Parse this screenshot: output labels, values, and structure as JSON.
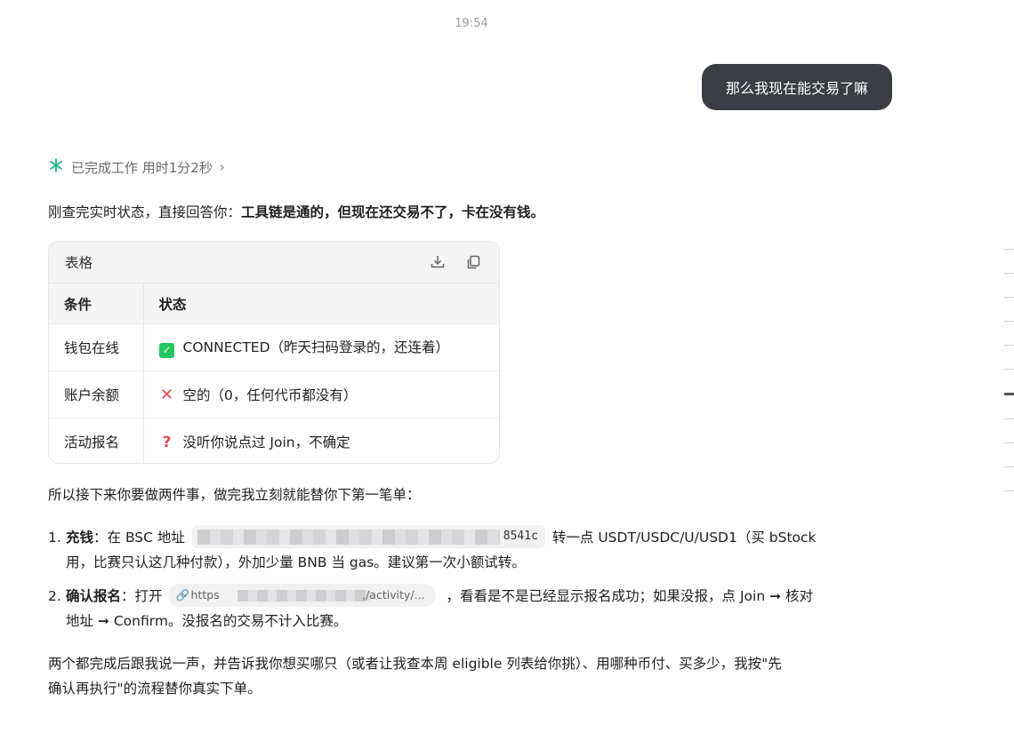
{
  "timestamp": "19:54",
  "user_message": "那么我现在能交易了嘛",
  "status": {
    "text": "已完成工作 用时1分2秒",
    "chevron": "›"
  },
  "intro": {
    "prefix": "刚查完实时状态，直接回答你：",
    "bold": "工具链是通的，但现在还交易不了，卡在没有钱。"
  },
  "table": {
    "label": "表格",
    "headers": [
      "条件",
      "状态"
    ],
    "rows": [
      {
        "condition": "钱包在线",
        "icon": "check-icon",
        "status": "CONNECTED（昨天扫码登录的，还连着）"
      },
      {
        "condition": "账户余额",
        "icon": "cross-icon",
        "status": "空的（0，任何代币都没有）"
      },
      {
        "condition": "活动报名",
        "icon": "question-icon",
        "status": "没听你说点过 Join，不确定"
      }
    ]
  },
  "paragraph2": "所以接下来你要做两件事，做完我立刻就能替你下第一笔单：",
  "steps": [
    {
      "num": "1.",
      "title": "充钱",
      "pre": "：在 BSC 地址",
      "address_tail": "8541c",
      "post_line1": "转一点 USDT/USDC/U/USD1（买 bStock",
      "line2": "用，比赛只认这几种付款），外加少量 BNB 当 gas。建议第一次小额试转。"
    },
    {
      "num": "2.",
      "title": "确认报名",
      "pre": "：打开",
      "link_start": "https",
      "link_end": ",/activity/...",
      "post_line1": "，看看是不是已经显示报名成功；如果没报，点 Join ➞ 核对",
      "line2": "地址 ➞ Confirm。没报名的交易不计入比赛。"
    }
  ],
  "paragraph3_line1": "两个都完成后跟我说一声，并告诉我你想买哪只（或者让我查本周 eligible 列表给你挑）、用哪种币付、买多少，我按\"先",
  "paragraph3_line2": "确认再执行\"的流程替你真实下单。"
}
